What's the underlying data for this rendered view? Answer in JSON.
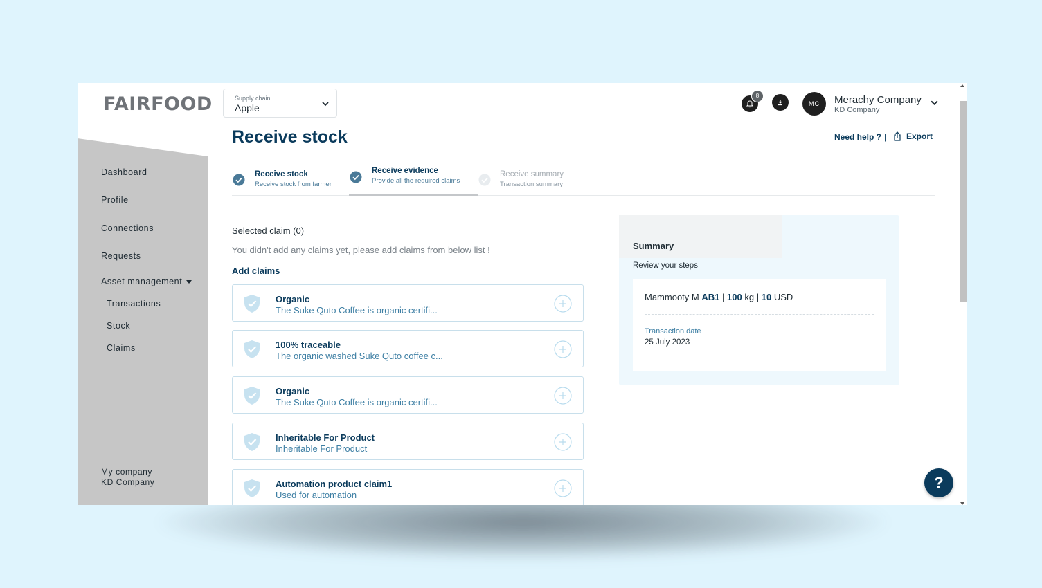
{
  "app": {
    "logo": "FAIRFOOD"
  },
  "supply_chain": {
    "label": "Supply chain",
    "value": "Apple"
  },
  "header": {
    "notification_count": "8",
    "avatar_initials": "MC",
    "user_name": "Merachy Company",
    "user_company": "KD Company"
  },
  "page": {
    "title": "Receive stock",
    "help_label": "Need help ?",
    "separator": "|",
    "export_label": "Export"
  },
  "sidebar": {
    "items": [
      {
        "label": "Dashboard"
      },
      {
        "label": "Profile"
      },
      {
        "label": "Connections"
      },
      {
        "label": "Requests"
      },
      {
        "label": "Asset management"
      },
      {
        "label": "Transactions"
      },
      {
        "label": "Stock"
      },
      {
        "label": "Claims"
      }
    ],
    "my_company_label": "My company",
    "my_company_value": "KD Company"
  },
  "stepper": {
    "steps": [
      {
        "title": "Receive stock",
        "subtitle": "Receive stock from farmer",
        "state": "done"
      },
      {
        "title": "Receive evidence",
        "subtitle": "Provide all the required claims",
        "state": "active"
      },
      {
        "title": "Receive summary",
        "subtitle": "Transaction summary",
        "state": "pending"
      }
    ]
  },
  "claims": {
    "selected_label": "Selected claim (0)",
    "empty_message": "You didn't add any claims yet, please add claims from below list !",
    "add_label": "Add claims",
    "list": [
      {
        "title": "Organic",
        "description": "The Suke Quto Coffee is organic certifi..."
      },
      {
        "title": "100% traceable",
        "description": "The organic washed Suke Quto coffee c..."
      },
      {
        "title": "Organic",
        "description": "The Suke Quto Coffee is organic certifi..."
      },
      {
        "title": "Inheritable For Product",
        "description": "Inheritable For Product"
      },
      {
        "title": "Automation product claim1",
        "description": "Used for automation"
      }
    ]
  },
  "summary": {
    "title": "Summary",
    "subtitle": "Review your steps",
    "farmer": "Mammooty M",
    "farmer_id": "AB1",
    "quantity": "100",
    "unit": "kg",
    "price": "10",
    "currency": "USD",
    "sep": "|",
    "date_label": "Transaction date",
    "date_value": "25 July 2023"
  },
  "help_fab": "?",
  "colors": {
    "primary": "#0b3b5c",
    "accent": "#3c7ea3",
    "sidebar_bg": "#c6c6c6",
    "page_bg": "#dff4fd"
  }
}
